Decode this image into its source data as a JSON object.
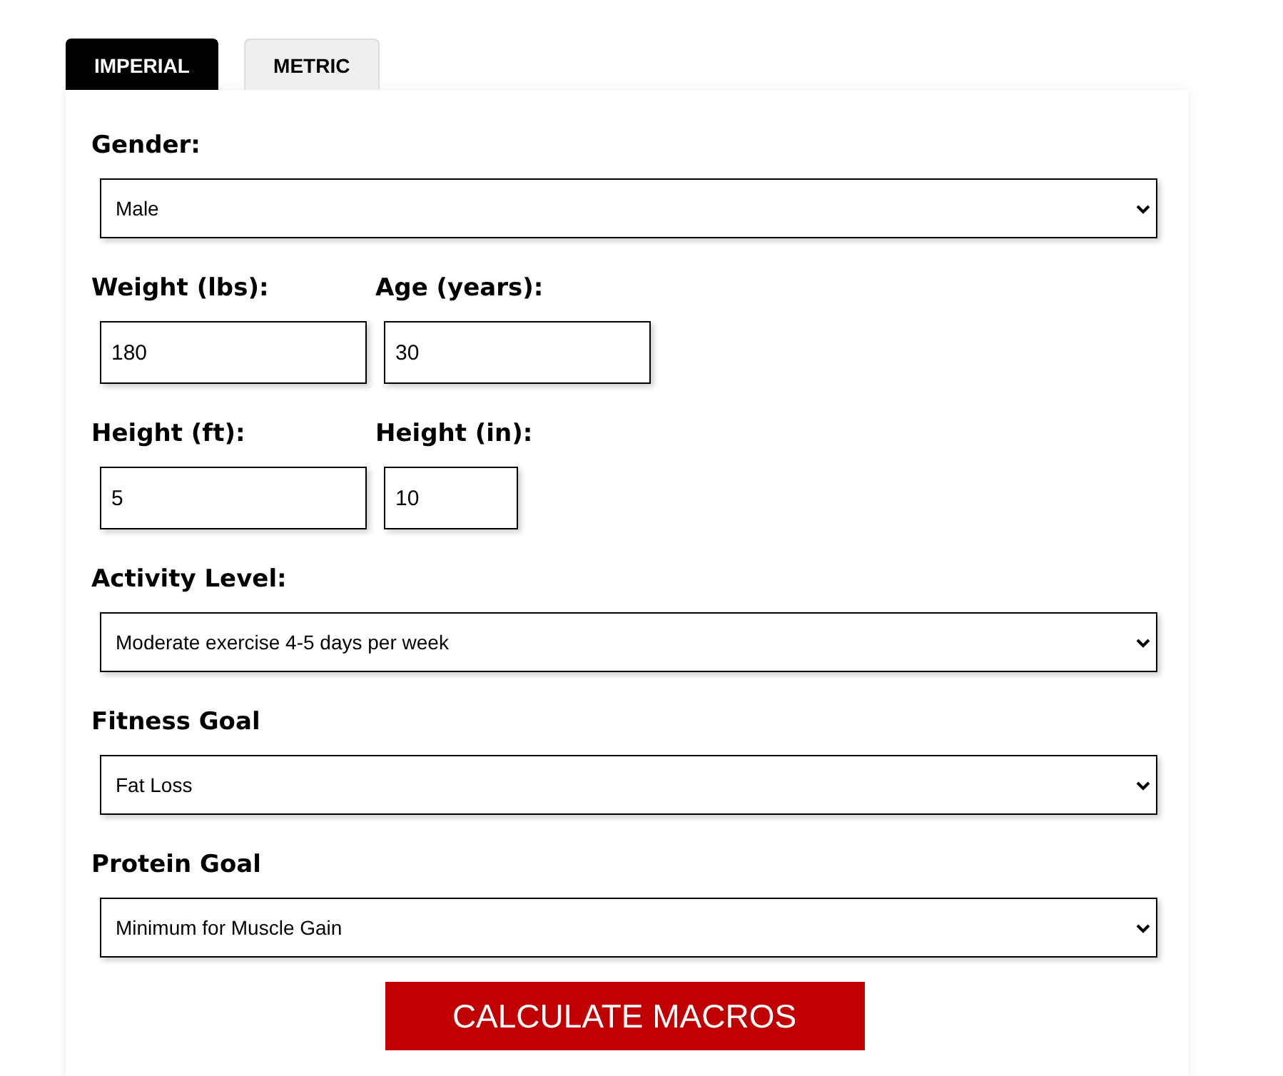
{
  "tabs": [
    {
      "label": "IMPERIAL",
      "selected": true
    },
    {
      "label": "METRIC",
      "selected": false
    }
  ],
  "rows": [
    [
      {
        "label": "Gender:",
        "kind": "select",
        "value": "Male"
      }
    ],
    [
      {
        "label": "Weight (lbs):",
        "kind": "input",
        "value": "180"
      },
      {
        "label": "Age (years):",
        "kind": "input",
        "value": "30"
      }
    ],
    [
      {
        "label": "Height (ft):",
        "kind": "input",
        "value": "5"
      },
      {
        "label": "Height (in):",
        "kind": "input-short",
        "value": "10"
      }
    ],
    [
      {
        "label": "Activity Level:",
        "kind": "select",
        "value": "Moderate exercise 4-5 days per week"
      }
    ],
    [
      {
        "label": "Fitness Goal",
        "kind": "select",
        "value": "Fat Loss"
      }
    ],
    [
      {
        "label": "Protein Goal",
        "kind": "select",
        "value": "Minimum for Muscle Gain"
      }
    ]
  ],
  "button": "CALCULATE MACROS"
}
